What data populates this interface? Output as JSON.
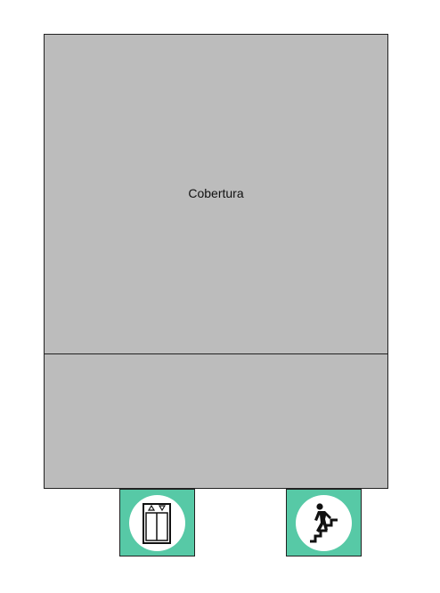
{
  "plan": {
    "roof_label": "Cobertura"
  },
  "signs": [
    {
      "icon": "elevator-icon"
    },
    {
      "icon": "stairs-icon"
    }
  ],
  "colors": {
    "area_fill": "#bcbcbc",
    "sign_fill": "#57c9a6",
    "outline": "#222222"
  }
}
